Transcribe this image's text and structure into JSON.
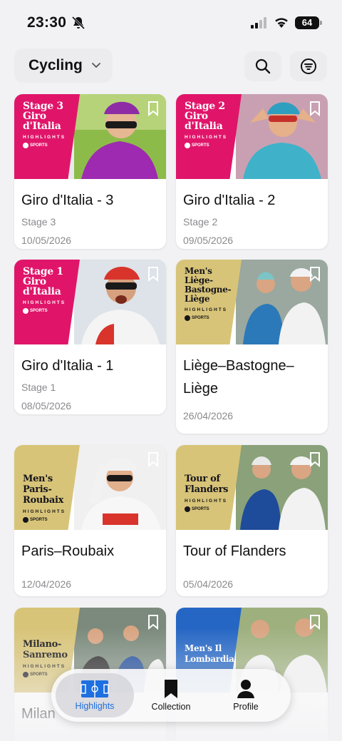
{
  "status": {
    "time": "23:30",
    "battery": "64"
  },
  "header": {
    "sport": "Cycling"
  },
  "cards": [
    {
      "title": "Giro d'Italia - 3",
      "subtitle": "Stage 3",
      "date": "10/05/2026",
      "thumb_text": "Stage 3 Giro d'Italia",
      "highlights": "HIGHLIGHTS",
      "network": "SPORTS",
      "theme": "pink"
    },
    {
      "title": "Giro d'Italia - 2",
      "subtitle": "Stage 2",
      "date": "09/05/2026",
      "thumb_text": "Stage 2 Giro d'Italia",
      "highlights": "HIGHLIGHTS",
      "network": "SPORTS",
      "theme": "pink"
    },
    {
      "title": "Giro d'Italia - 1",
      "subtitle": "Stage 1",
      "date": "08/05/2026",
      "thumb_text": "Stage 1 Giro d'Italia",
      "highlights": "HIGHLIGHTS",
      "network": "SPORTS",
      "theme": "pink"
    },
    {
      "title": "Liège–Bastogne–Liège",
      "subtitle": "",
      "date": "26/04/2026",
      "thumb_text": "Men's Liège-Bastogne-Liège",
      "highlights": "HIGHLIGHTS",
      "network": "SPORTS",
      "theme": "gold"
    },
    {
      "title": "Paris–Roubaix",
      "subtitle": "",
      "date": "12/04/2026",
      "thumb_text": "Men's Paris-Roubaix",
      "highlights": "HIGHLIGHTS",
      "network": "SPORTS",
      "theme": "gold"
    },
    {
      "title": "Tour of Flanders",
      "subtitle": "",
      "date": "05/04/2026",
      "thumb_text": "Tour of Flanders",
      "highlights": "HIGHLIGHTS",
      "network": "SPORTS",
      "theme": "gold"
    },
    {
      "title": "Milan",
      "subtitle": "",
      "date": "",
      "thumb_text": "Milano-Sanremo",
      "highlights": "HIGHLIGHTS",
      "network": "SPORTS",
      "theme": "gold"
    },
    {
      "title": "",
      "subtitle": "",
      "date": "",
      "thumb_text": "Men's Il Lombardia",
      "highlights": "",
      "network": "",
      "theme": "blue"
    }
  ],
  "tabs": [
    {
      "label": "Highlights",
      "icon": "pitch-icon"
    },
    {
      "label": "Collection",
      "icon": "bookmark-icon"
    },
    {
      "label": "Profile",
      "icon": "person-icon"
    }
  ],
  "colors": {
    "accent": "#1e6fe0",
    "pink": "#e0156a",
    "gold": "#d8c478"
  }
}
